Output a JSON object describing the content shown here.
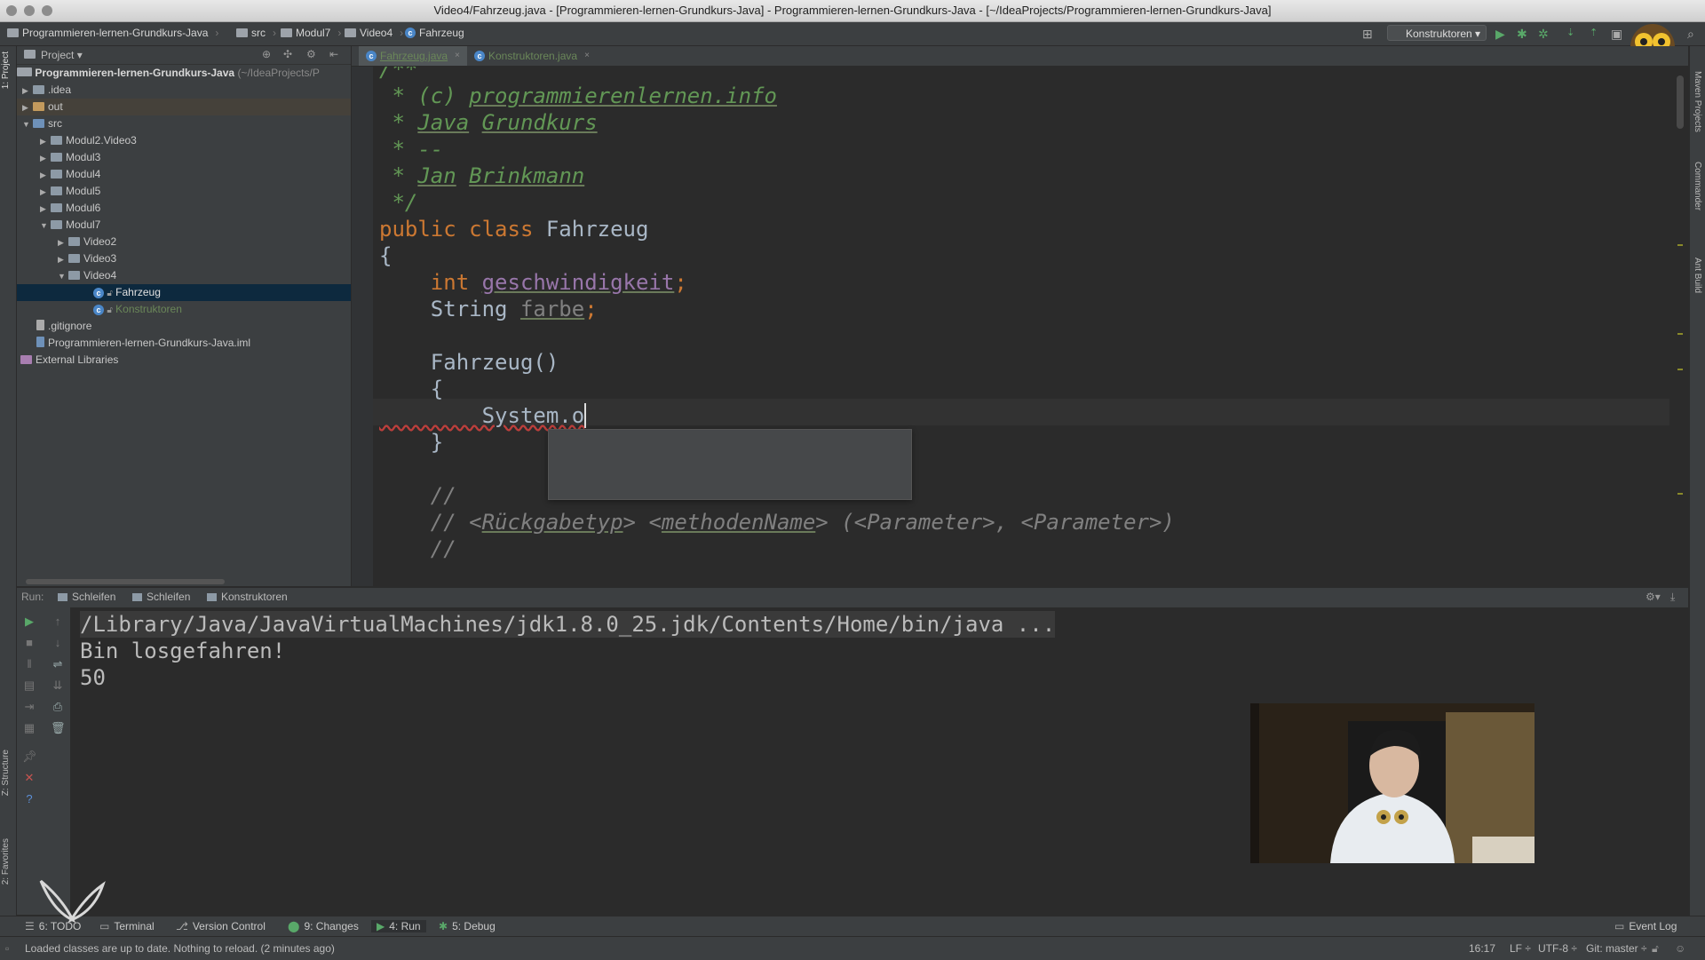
{
  "window": {
    "title": "Video4/Fahrzeug.java - [Programmieren-lernen-Grundkurs-Java] - Programmieren-lernen-Grundkurs-Java - [~/IdeaProjects/Programmieren-lernen-Grundkurs-Java]"
  },
  "breadcrumbs": [
    "Programmieren-lernen-Grundkurs-Java",
    "src",
    "Modul7",
    "Video4",
    "Fahrzeug"
  ],
  "toolbar": {
    "run_config": "Konstruktoren"
  },
  "left_tool_tabs": {
    "project": "1: Project",
    "structure": "Z: Structure",
    "favorites": "2: Favorites"
  },
  "right_tool_tabs": {
    "maven": "Maven Projects",
    "commander": "Commander",
    "ant": "Ant Build"
  },
  "project_panel": {
    "header": "Project",
    "root": "Programmieren-lernen-Grundkurs-Java",
    "root_path": "(~/IdeaProjects/P",
    "items": [
      ".idea",
      "out",
      "src",
      "Modul2.Video3",
      "Modul3",
      "Modul4",
      "Modul5",
      "Modul6",
      "Modul7",
      "Video2",
      "Video3",
      "Video4",
      "Fahrzeug",
      "Konstruktoren",
      ".gitignore",
      "Programmieren-lernen-Grundkurs-Java.iml",
      "External Libraries"
    ]
  },
  "editor_tabs": [
    {
      "label": "Fahrzeug.java"
    },
    {
      "label": "Konstruktoren.java"
    }
  ],
  "code": {
    "l1": "/**",
    "l2a": " * (c) ",
    "l2b": "programmierenlernen.info",
    "l3a": " * ",
    "l3b": "Java",
    "l3c": " ",
    "l3d": "Grundkurs",
    "l4": " * --",
    "l5a": " * ",
    "l5b": "Jan",
    "l5c": " ",
    "l5d": "Brinkmann",
    "l6": " */",
    "l7a": "public class ",
    "l7b": "Fahrzeug",
    "l8": "{",
    "l9a": "    int ",
    "l9b": "geschwindigkeit",
    "l9c": ";",
    "l10a": "    String ",
    "l10b": "farbe",
    "l10c": ";",
    "l11": "    Fahrzeug()",
    "l12": "    {",
    "l13": "        System.o",
    "l14": "    }",
    "l15": "    //",
    "l16a": "    // <",
    "l16b": "Rückgabetyp",
    "l16c": "> <",
    "l16d": "methodenName",
    "l16e": "> (<Parameter>, <Parameter>)",
    "l17": "    //"
  },
  "run_panel": {
    "label": "Run:",
    "tabs": [
      "Schleifen",
      "Schleifen",
      "Konstruktoren"
    ],
    "console": [
      "/Library/Java/JavaVirtualMachines/jdk1.8.0_25.jdk/Contents/Home/bin/java ...",
      "Bin losgefahren!",
      "50"
    ]
  },
  "bottom_tabs": [
    {
      "label": "6: TODO"
    },
    {
      "label": "Terminal"
    },
    {
      "label": "Version Control"
    },
    {
      "label": "9: Changes"
    },
    {
      "label": "4: Run"
    },
    {
      "label": "5: Debug"
    }
  ],
  "event_log": "Event Log",
  "status": {
    "message": "Loaded classes are up to date. Nothing to reload. (2 minutes ago)",
    "position": "16:17",
    "line_sep": "LF ÷",
    "encoding": "UTF-8 ÷",
    "git": "Git: master ÷"
  },
  "colors": {
    "accent": "#4a86c7",
    "run_green": "#59a869",
    "comment": "#629755",
    "keyword": "#cc7832",
    "field": "#9876aa"
  }
}
